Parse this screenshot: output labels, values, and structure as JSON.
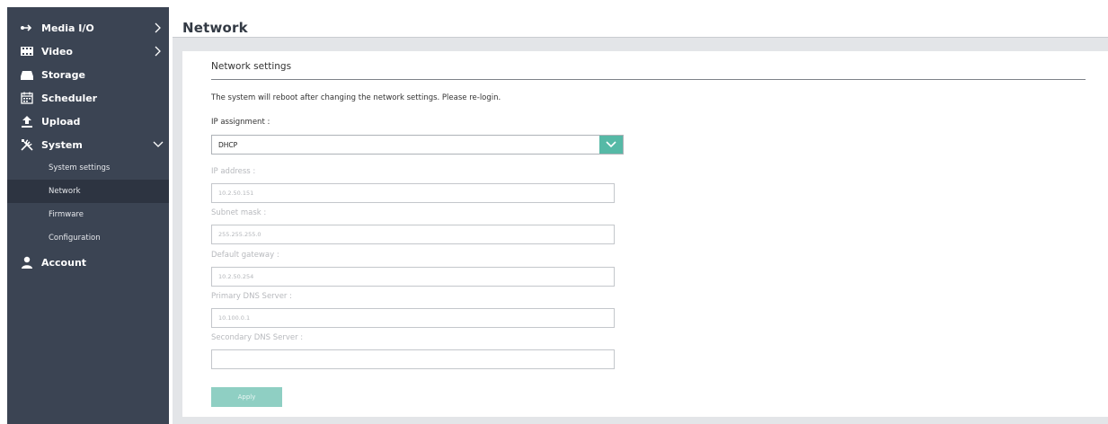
{
  "colors": {
    "sidebar_bg": "#3b4453",
    "sidebar_active_bg": "#2d3441",
    "accent": "#56b9a6",
    "apply_button": "#8fcfc3"
  },
  "sidebar": {
    "items": [
      {
        "label": "Media I/O",
        "icon": "media-io-icon",
        "chevron": "right"
      },
      {
        "label": "Video",
        "icon": "video-icon",
        "chevron": "right"
      },
      {
        "label": "Storage",
        "icon": "storage-icon"
      },
      {
        "label": "Scheduler",
        "icon": "calendar-icon"
      },
      {
        "label": "Upload",
        "icon": "upload-icon"
      },
      {
        "label": "System",
        "icon": "tools-icon",
        "chevron": "down"
      },
      {
        "label": "Account",
        "icon": "user-icon"
      }
    ],
    "system_subitems": [
      {
        "label": "System settings"
      },
      {
        "label": "Network",
        "active": true
      },
      {
        "label": "Firmware"
      },
      {
        "label": "Configuration"
      }
    ]
  },
  "page": {
    "title": "Network"
  },
  "network": {
    "section_title": "Network settings",
    "notice": "The system will reboot after changing the network settings. Please re-login.",
    "ip_assignment_label": "IP assignment :",
    "ip_assignment_value": "DHCP",
    "fields": [
      {
        "label": "IP address :",
        "value": "10.2.50.151"
      },
      {
        "label": "Subnet mask :",
        "value": "255.255.255.0"
      },
      {
        "label": "Default gateway :",
        "value": "10.2.50.254"
      },
      {
        "label": "Primary DNS Server :",
        "value": "10.100.0.1"
      },
      {
        "label": "Secondary DNS Server :",
        "value": ""
      }
    ],
    "apply_label": "Apply"
  }
}
